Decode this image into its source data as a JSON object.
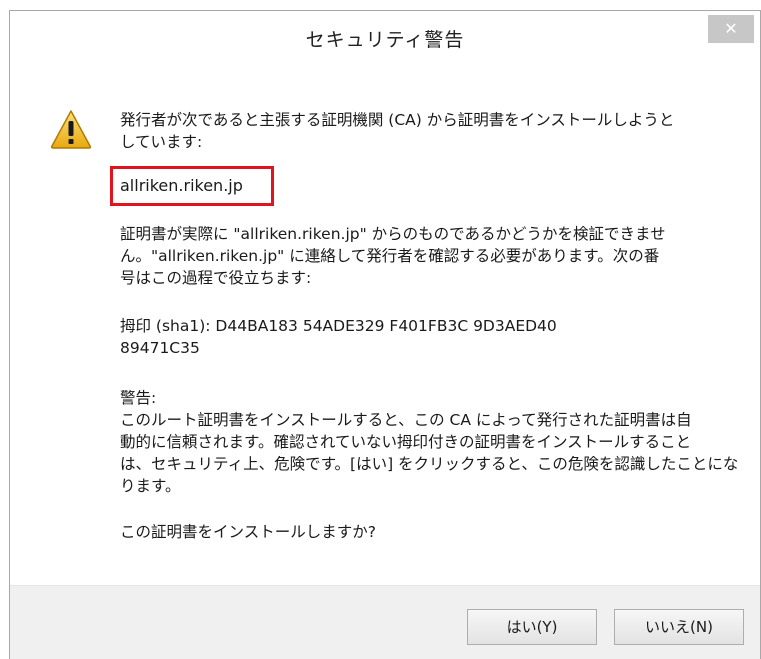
{
  "dialog": {
    "title": "セキュリティ警告",
    "close_symbol": "✕",
    "icon": "warning-icon",
    "colors": {
      "highlight_border": "#e0141e",
      "warning_fill": "#f2c01e"
    }
  },
  "message": {
    "intro_line1": "発行者が次であると主張する証明機関 (CA) から証明書をインストールしようと",
    "intro_line2": "しています:",
    "issuer": "allriken.riken.jp",
    "verify_line1": "証明書が実際に \"allriken.riken.jp\" からのものであるかどうかを検証できませ",
    "verify_line2": "ん。\"allriken.riken.jp\" に連絡して発行者を確認する必要があります。次の番",
    "verify_line3": "号はこの過程で役立ちます:",
    "thumbprint_line1": "拇印 (sha1): D44BA183 54ADE329 F401FB3C 9D3AED40",
    "thumbprint_line2": "89471C35",
    "warning_heading": "警告:",
    "warning_line1": "このルート証明書をインストールすると、この CA によって発行された証明書は自",
    "warning_line2": "動的に信頼されます。確認されていない拇印付きの証明書をインストールすること",
    "warning_line3": "は、セキュリティ上、危険です。[はい] をクリックすると、この危険を認識したことにな",
    "warning_line4": "ります。",
    "question": "この証明書をインストールしますか?"
  },
  "buttons": {
    "yes_label": "はい(Y)",
    "no_label": "いいえ(N)"
  }
}
